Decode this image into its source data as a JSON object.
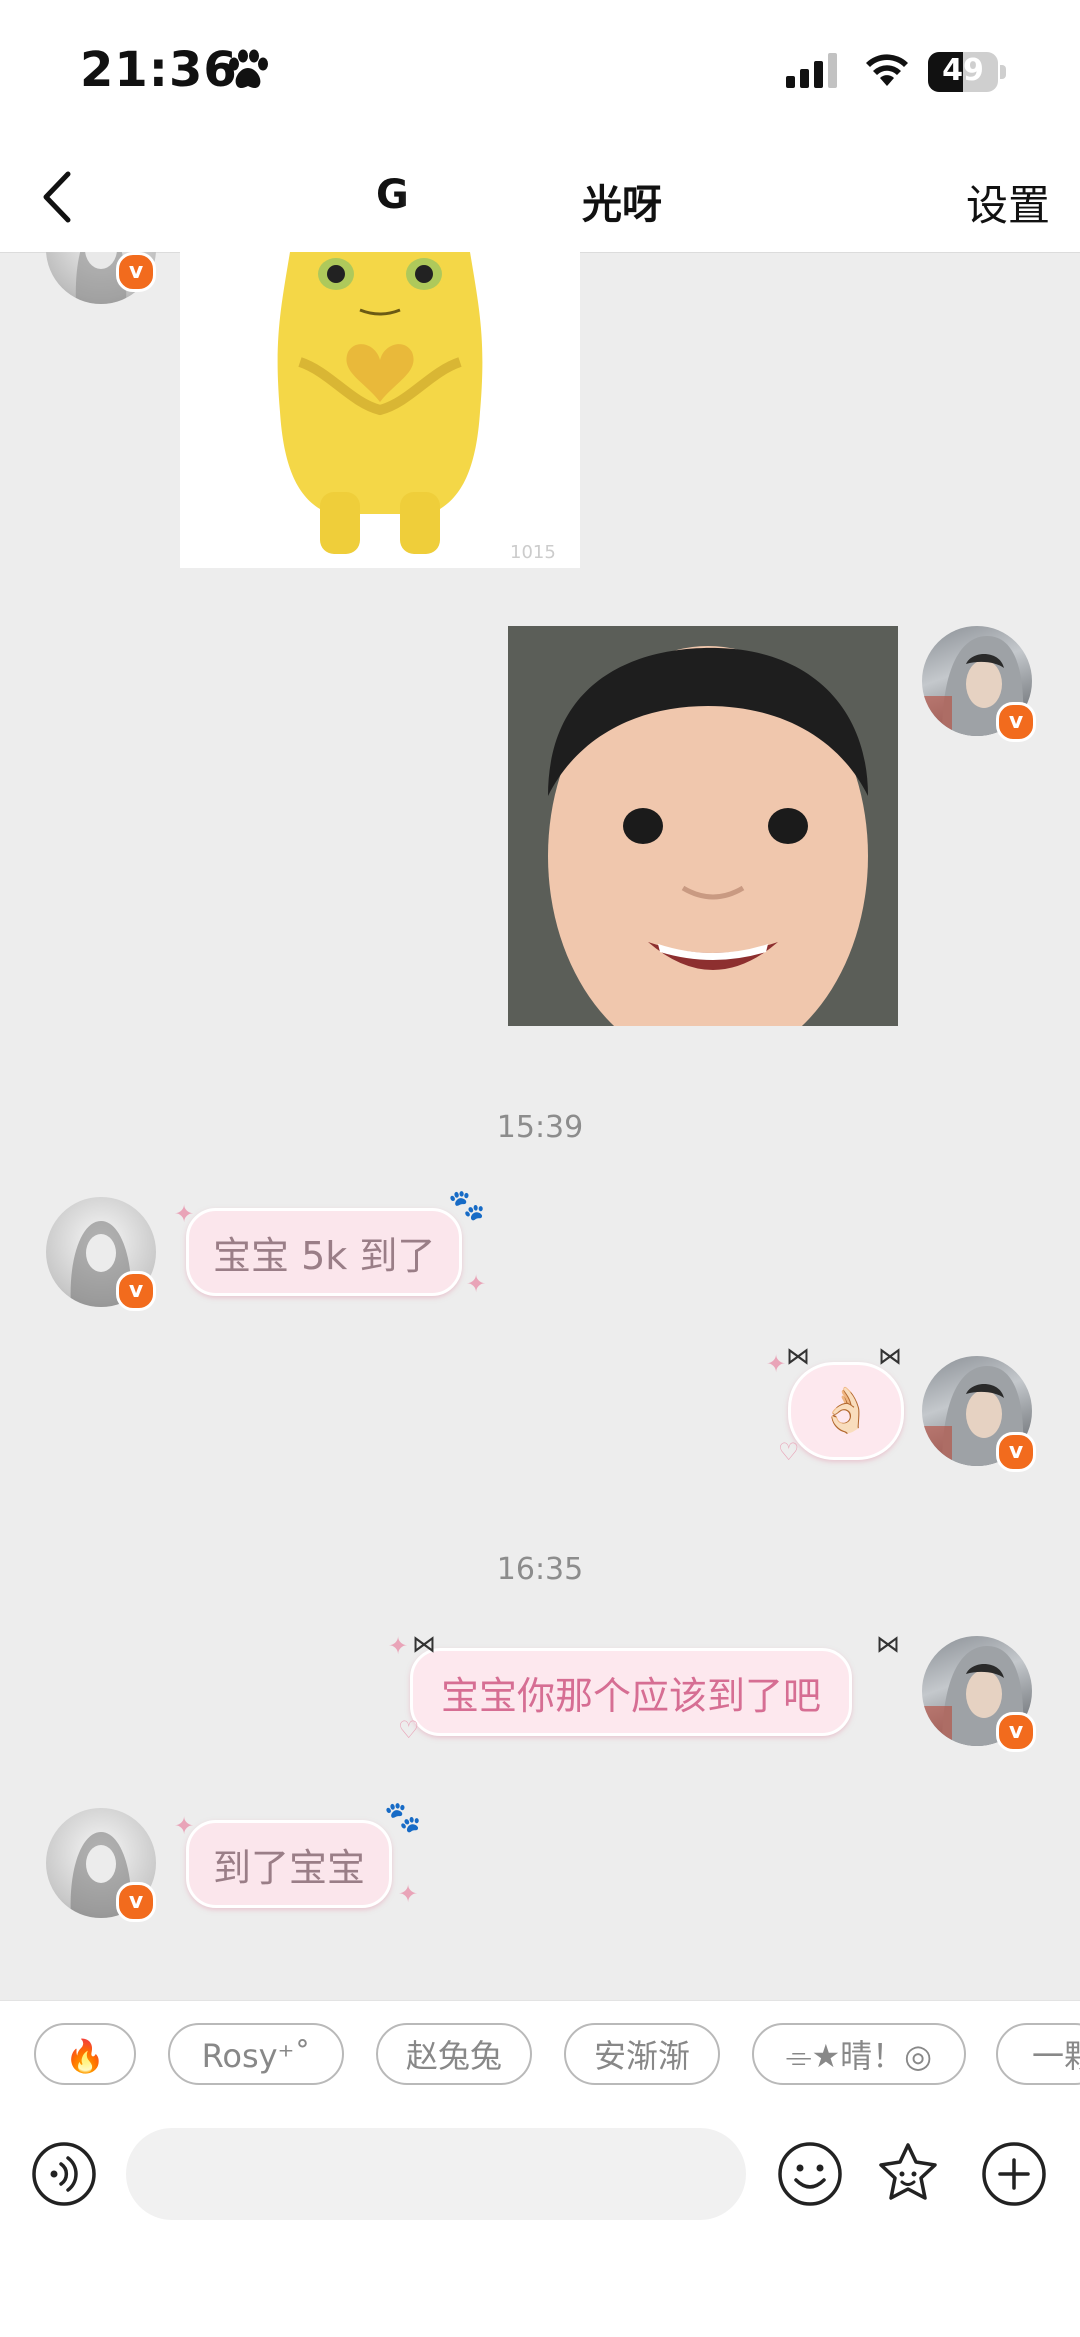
{
  "status_bar": {
    "time": "21:36",
    "battery_level": "49"
  },
  "nav": {
    "title_left": "G",
    "title_right": "光呀",
    "settings_label": "设置"
  },
  "messages": {
    "timestamp_1": "15:39",
    "timestamp_2": "16:35",
    "received_1": "宝宝 5k 到了",
    "sent_1_emoji": "👌🏻",
    "sent_2": "宝宝你那个应该到了吧",
    "received_2": "到了宝宝",
    "image_watermark": "1015"
  },
  "quick_replies": [
    "🔥",
    "Rosy⁺˚",
    "赵兔兔",
    "安渐渐",
    "⌯★晴！◎",
    "一颗"
  ],
  "colors": {
    "accent_badge": "#f26b1d",
    "bubble_text": "#d66e93",
    "background": "#ededed"
  }
}
